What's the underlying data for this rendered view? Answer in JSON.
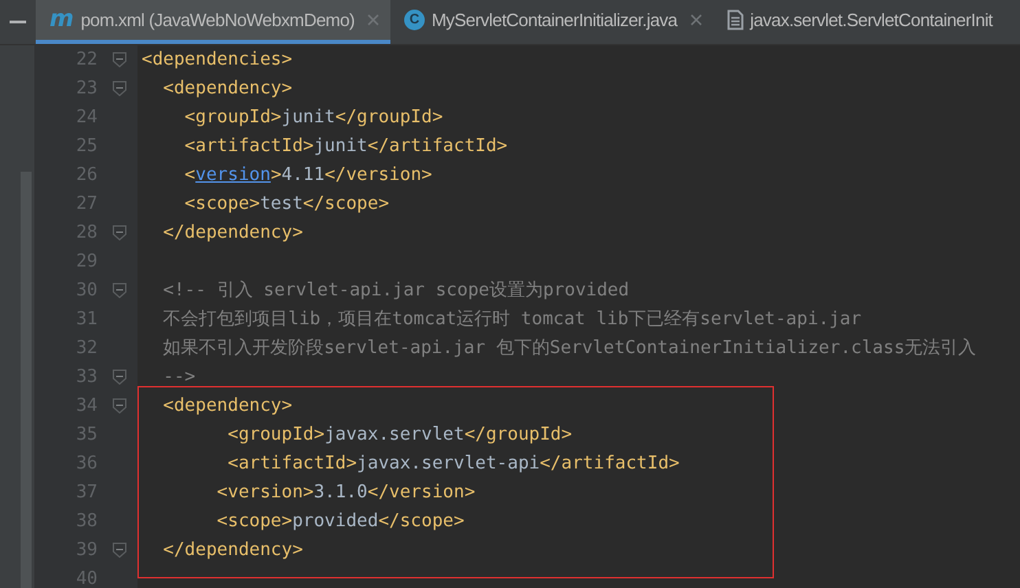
{
  "tabs": [
    {
      "icon_text": "m",
      "label": "pom.xml (JavaWebNoWebxmDemo)",
      "selected": true,
      "closable": true
    },
    {
      "icon_text": "C",
      "label": "MyServletContainerInitializer.java",
      "selected": false,
      "closable": true
    },
    {
      "label": "javax.servlet.ServletContainerInit",
      "selected": false,
      "closable": false
    }
  ],
  "editor": {
    "lines": [
      {
        "number": "22",
        "fold": true,
        "highlighted": false,
        "tokens": [
          {
            "kind": "tag",
            "text": "<dependencies>"
          }
        ]
      },
      {
        "number": "23",
        "fold": true,
        "highlighted": false,
        "tokens": [
          {
            "kind": "tag",
            "text": "  <dependency>"
          }
        ]
      },
      {
        "number": "24",
        "fold": false,
        "highlighted": false,
        "tokens": [
          {
            "kind": "tag",
            "text": "    <groupId>"
          },
          {
            "kind": "text",
            "text": "junit"
          },
          {
            "kind": "tag",
            "text": "</groupId>"
          }
        ]
      },
      {
        "number": "25",
        "fold": false,
        "highlighted": false,
        "tokens": [
          {
            "kind": "tag",
            "text": "    <artifactId>"
          },
          {
            "kind": "text",
            "text": "junit"
          },
          {
            "kind": "tag",
            "text": "</artifactId>"
          }
        ]
      },
      {
        "number": "26",
        "fold": false,
        "highlighted": false,
        "tokens": [
          {
            "kind": "tag",
            "text": "    <"
          },
          {
            "kind": "link",
            "text": "version"
          },
          {
            "kind": "tag",
            "text": ">"
          },
          {
            "kind": "text",
            "text": "4.11"
          },
          {
            "kind": "tag",
            "text": "</version>"
          }
        ]
      },
      {
        "number": "27",
        "fold": false,
        "highlighted": false,
        "tokens": [
          {
            "kind": "tag",
            "text": "    <scope>"
          },
          {
            "kind": "text",
            "text": "test"
          },
          {
            "kind": "tag",
            "text": "</scope>"
          }
        ]
      },
      {
        "number": "28",
        "fold": true,
        "highlighted": false,
        "tokens": [
          {
            "kind": "tag",
            "text": "  </dependency>"
          }
        ]
      },
      {
        "number": "29",
        "fold": false,
        "highlighted": false
      },
      {
        "number": "30",
        "fold": true,
        "highlighted": false,
        "tokens": [
          {
            "kind": "comment",
            "text": "  <!-- 引入 servlet-api.jar scope设置为provided"
          }
        ]
      },
      {
        "number": "31",
        "fold": false,
        "highlighted": false,
        "tokens": [
          {
            "kind": "comment",
            "text": "  不会打包到项目lib，项目在tomcat运行时 tomcat lib下已经有servlet-api.jar"
          }
        ]
      },
      {
        "number": "32",
        "fold": false,
        "highlighted": false,
        "tokens": [
          {
            "kind": "comment",
            "text": "  如果不引入开发阶段servlet-api.jar 包下的ServletContainerInitializer.class无法引入"
          }
        ]
      },
      {
        "number": "33",
        "fold": true,
        "highlighted": false,
        "tokens": [
          {
            "kind": "comment",
            "text": "  -->"
          }
        ]
      },
      {
        "number": "34",
        "fold": true,
        "highlighted": true,
        "tokens": [
          {
            "kind": "tag",
            "text": "  <dependency>"
          }
        ]
      },
      {
        "number": "35",
        "fold": false,
        "highlighted": true,
        "tokens": [
          {
            "kind": "tag",
            "text": "        <groupId>"
          },
          {
            "kind": "text",
            "text": "javax.servlet"
          },
          {
            "kind": "tag",
            "text": "</groupId>"
          }
        ]
      },
      {
        "number": "36",
        "fold": false,
        "highlighted": true,
        "tokens": [
          {
            "kind": "tag",
            "text": "        <artifactId>"
          },
          {
            "kind": "text",
            "text": "javax.servlet-api"
          },
          {
            "kind": "tag",
            "text": "</artifactId>"
          }
        ]
      },
      {
        "number": "37",
        "fold": false,
        "highlighted": true,
        "tokens": [
          {
            "kind": "tag",
            "text": "       <version>"
          },
          {
            "kind": "text",
            "text": "3.1.0"
          },
          {
            "kind": "tag",
            "text": "</version>"
          }
        ]
      },
      {
        "number": "38",
        "fold": false,
        "highlighted": true,
        "tokens": [
          {
            "kind": "tag",
            "text": "       <scope>"
          },
          {
            "kind": "text",
            "text": "provided"
          },
          {
            "kind": "tag",
            "text": "</scope>"
          }
        ]
      },
      {
        "number": "39",
        "fold": true,
        "highlighted": true,
        "tokens": [
          {
            "kind": "tag",
            "text": "  </dependency>"
          }
        ]
      },
      {
        "number": "40",
        "fold": false,
        "highlighted": false
      }
    ]
  }
}
